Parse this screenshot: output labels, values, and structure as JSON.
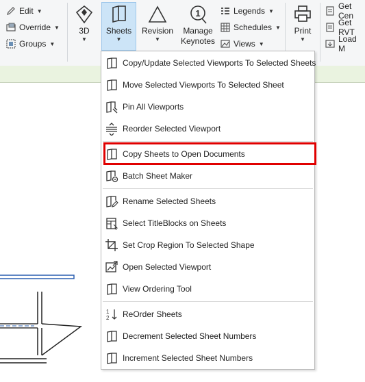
{
  "ribbon": {
    "edit_label": "Edit",
    "override_label": "Override",
    "groups_label": "Groups",
    "threed_label": "3D",
    "sheets_label": "Sheets",
    "revision_label": "Revision",
    "manage_label_1": "Manage",
    "manage_label_2": "Keynotes",
    "legends_label": "Legends",
    "schedules_label": "Schedules",
    "views_label": "Views",
    "print_label": "Print",
    "get_cen_label": "Get Cen",
    "get_rvt_label": "Get RVT",
    "load_label": "Load M"
  },
  "menu": {
    "items": [
      {
        "label": "Copy/Update Selected Viewports To Selected Sheets",
        "icon": "sheet-icon"
      },
      {
        "label": "Move Selected Viewports To Selected Sheet",
        "icon": "sheet-icon"
      },
      {
        "label": "Pin All Viewports",
        "icon": "pin-sheet-icon"
      },
      {
        "label": "Reorder Selected Viewport",
        "icon": "reorder-icon"
      },
      {
        "label": "Copy Sheets to Open Documents",
        "icon": "sheet-icon"
      },
      {
        "label": "Batch Sheet Maker",
        "icon": "batch-sheet-icon"
      },
      {
        "label": "Rename Selected Sheets",
        "icon": "rename-sheet-icon"
      },
      {
        "label": "Select TitleBlocks on Sheets",
        "icon": "titleblock-icon"
      },
      {
        "label": "Set Crop Region To Selected Shape",
        "icon": "crop-icon"
      },
      {
        "label": "Open Selected Viewport",
        "icon": "open-viewport-icon"
      },
      {
        "label": "View Ordering Tool",
        "icon": "sheet-icon"
      },
      {
        "label": "ReOrder Sheets",
        "icon": "sort-icon"
      },
      {
        "label": "Decrement Selected Sheet Numbers",
        "icon": "sheet-icon"
      },
      {
        "label": "Increment Selected Sheet Numbers",
        "icon": "sheet-icon"
      }
    ]
  },
  "colors": {
    "accent": "#cce4f7",
    "highlight": "#e00000",
    "strip": "#eaf3e0"
  }
}
